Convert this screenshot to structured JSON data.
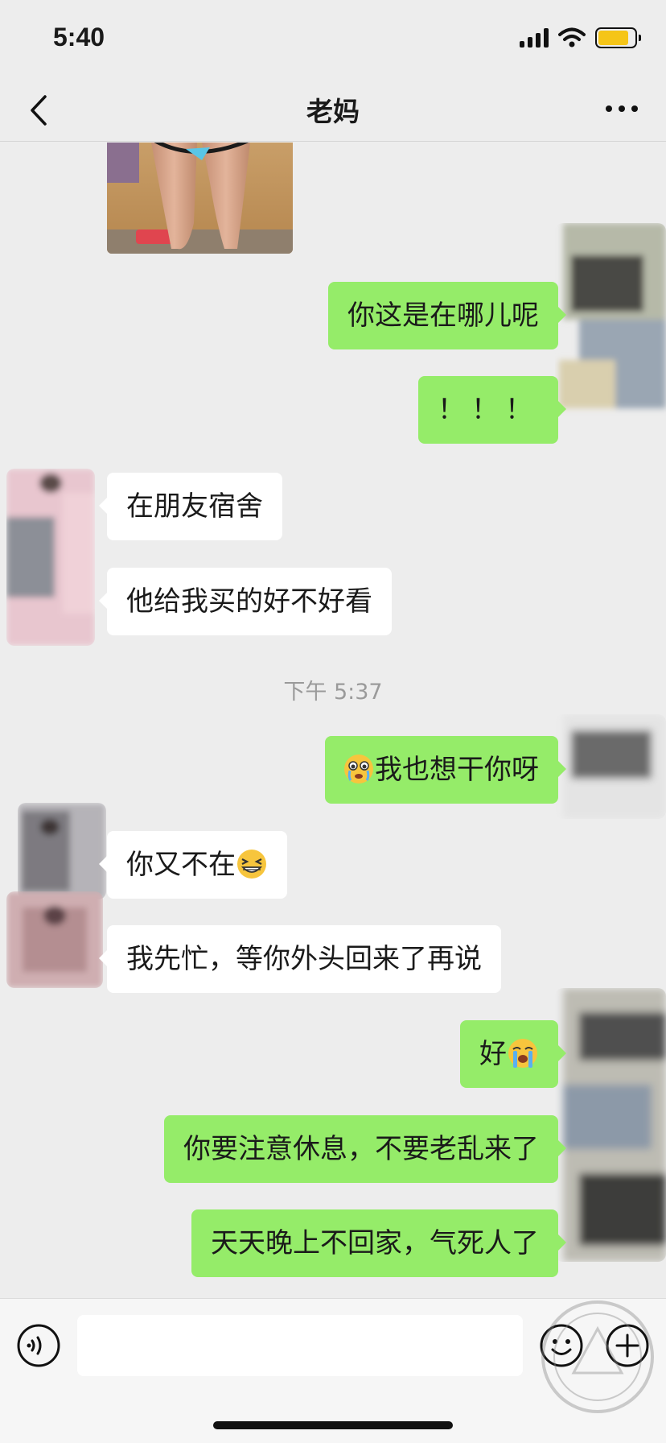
{
  "status": {
    "time": "5:40",
    "battery_level": 0.85,
    "icons": [
      "signal-icon",
      "wifi-icon",
      "battery-icon"
    ]
  },
  "nav": {
    "title": "老妈",
    "icons": [
      "back-icon",
      "more-icon"
    ]
  },
  "chat": {
    "timestamp": "下午 5:37",
    "messages": [
      {
        "from": "contact",
        "type": "image"
      },
      {
        "from": "me",
        "text": "你这是在哪儿呢"
      },
      {
        "from": "me",
        "text": "！！！"
      },
      {
        "from": "contact",
        "text": "在朋友宿舍"
      },
      {
        "from": "contact",
        "text": "他给我买的好不好看"
      },
      {
        "from": "me",
        "text": "我也想干你呀",
        "emoji": "crying-face-emoji"
      },
      {
        "from": "contact",
        "text": "你又不在",
        "emoji": "grinning-squint-emoji"
      },
      {
        "from": "contact",
        "text": "我先忙，等你外头回来了再说"
      },
      {
        "from": "me",
        "text": "好",
        "emoji": "loudly-crying-emoji"
      },
      {
        "from": "me",
        "text": "你要注意休息，不要老乱来了"
      },
      {
        "from": "me",
        "text": "天天晚上不回家，气死人了"
      }
    ]
  },
  "input": {
    "value": "",
    "icons": [
      "voice-icon",
      "emoji-icon",
      "plus-icon"
    ]
  },
  "colors": {
    "background": "#ededed",
    "outgoing_bubble": "#95ec69",
    "incoming_bubble": "#ffffff",
    "battery": "#f5c518"
  }
}
